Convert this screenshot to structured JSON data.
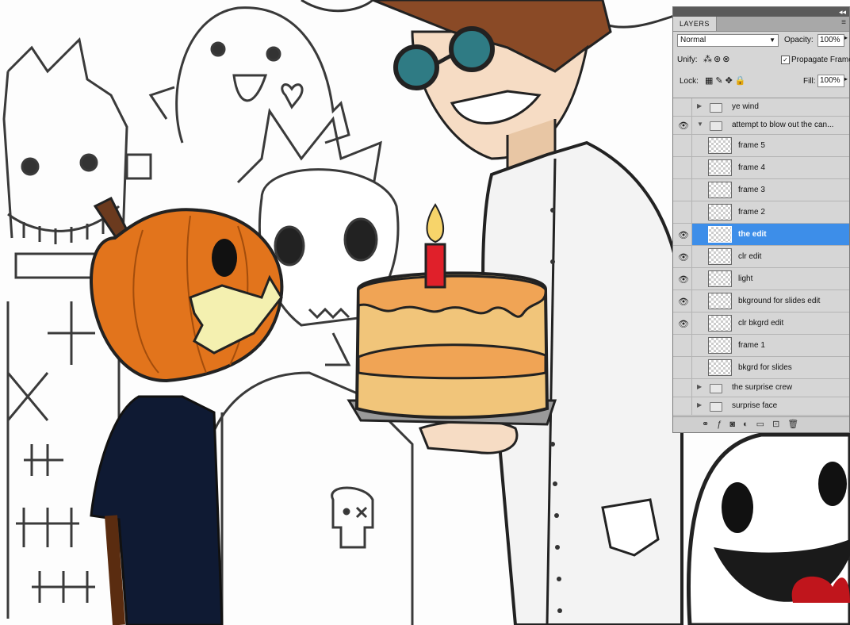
{
  "layers_panel": {
    "tab_title": "LAYERS",
    "blend_mode": "Normal",
    "opacity_label": "Opacity:",
    "opacity_value": "100%",
    "unify_label": "Unify:",
    "propagate_frame_label": "Propagate Frame",
    "propagate_frame_checked": true,
    "lock_label": "Lock:",
    "fill_label": "Fill:",
    "fill_value": "100%",
    "layers": [
      {
        "name": "ye wind",
        "type": "group",
        "visible": false,
        "expanded": false
      },
      {
        "name": "attempt to blow out the can...",
        "type": "group",
        "visible": true,
        "expanded": true
      },
      {
        "name": "frame 5",
        "type": "layer",
        "visible": false,
        "selected": false
      },
      {
        "name": "frame 4",
        "type": "layer",
        "visible": false,
        "selected": false
      },
      {
        "name": "frame 3",
        "type": "layer",
        "visible": false,
        "selected": false
      },
      {
        "name": "frame 2",
        "type": "layer",
        "visible": false,
        "selected": false
      },
      {
        "name": "the edit",
        "type": "layer",
        "visible": true,
        "selected": true
      },
      {
        "name": "clr edit",
        "type": "layer",
        "visible": true,
        "selected": false
      },
      {
        "name": "light",
        "type": "layer",
        "visible": true,
        "selected": false
      },
      {
        "name": "bkground for slides edit",
        "type": "layer",
        "visible": true,
        "selected": false
      },
      {
        "name": "clr bkgrd edit",
        "type": "layer",
        "visible": true,
        "selected": false
      },
      {
        "name": "frame 1",
        "type": "layer",
        "visible": false,
        "selected": false
      },
      {
        "name": "bkgrd for slides",
        "type": "layer",
        "visible": false,
        "selected": false
      },
      {
        "name": "the surprise crew",
        "type": "group",
        "visible": false,
        "expanded": false
      },
      {
        "name": "surprise face",
        "type": "group",
        "visible": false,
        "expanded": false
      }
    ]
  },
  "colors": {
    "selection": "#3d8ee9",
    "panel_bg": "#d6d6d6",
    "pumpkin": "#e2741c",
    "shirt": "#0f1a33",
    "cake": "#f1c57a",
    "frosting": "#f0a455",
    "candle": "#e0202a",
    "hair": "#8a4a26"
  }
}
